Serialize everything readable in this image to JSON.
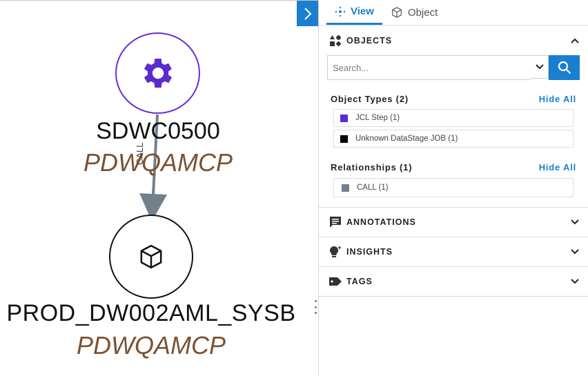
{
  "graph": {
    "nodes": [
      {
        "name": "SDWC0500",
        "subtitle": "PDWQAMCP",
        "icon": "gear-icon",
        "color": "#6a2bd8"
      },
      {
        "name": "PROD_DW002AML_SYSB",
        "subtitle": "PDWQAMCP",
        "icon": "cube-icon",
        "color": "#111111"
      }
    ],
    "edge": {
      "label": "CALL",
      "color": "#71808d"
    }
  },
  "panel": {
    "tabs": [
      {
        "label": "View",
        "icon": "graph-icon",
        "active": true
      },
      {
        "label": "Object",
        "icon": "cube-icon",
        "active": false
      }
    ],
    "objects": {
      "title": "OBJECTS",
      "search": {
        "placeholder": "Search...",
        "value": ""
      },
      "object_types": {
        "title": "Object Types (2)",
        "hide_label": "Hide All",
        "items": [
          {
            "label": "JCL Step (1)",
            "color": "#5b2bd0"
          },
          {
            "label": "Unknown DataStage JOB (1)",
            "color": "#000000"
          }
        ]
      },
      "relationships": {
        "title": "Relationships (1)",
        "hide_label": "Hide All",
        "items": [
          {
            "label": "CALL (1)",
            "color": "#71808d"
          }
        ]
      }
    },
    "sections": [
      {
        "title": "ANNOTATIONS",
        "icon": "comment-icon"
      },
      {
        "title": "INSIGHTS",
        "icon": "lightbulb-icon"
      },
      {
        "title": "TAGS",
        "icon": "tag-icon"
      }
    ]
  },
  "colors": {
    "accent": "#1a7fd0"
  }
}
